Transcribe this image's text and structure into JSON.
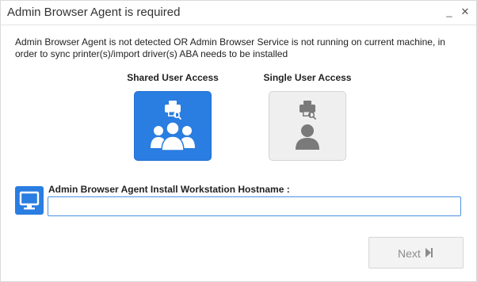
{
  "window": {
    "title": "Admin Browser Agent is required",
    "minimize_glyph": "_",
    "close_glyph": "✕"
  },
  "message": "Admin Browser Agent is not detected OR Admin Browser Service is not running on current machine, in order to sync printer(s)/import driver(s) ABA needs to be installed",
  "access_options": [
    {
      "label": "Shared User Access",
      "icon": "users-printer-icon",
      "selected": true
    },
    {
      "label": "Single User Access",
      "icon": "user-printer-icon",
      "selected": false
    }
  ],
  "hostname": {
    "label": "Admin Browser Agent Install Workstation Hostname :",
    "value": "",
    "placeholder": "",
    "icon": "monitor-icon"
  },
  "footer": {
    "next_label": "Next",
    "next_icon": "skip-next-icon",
    "next_enabled": false
  },
  "colors": {
    "accent": "#2a7de1",
    "tile_inactive": "#efefef",
    "icon_inactive": "#7a7a7a",
    "button_disabled_text": "#8c8c8c"
  }
}
